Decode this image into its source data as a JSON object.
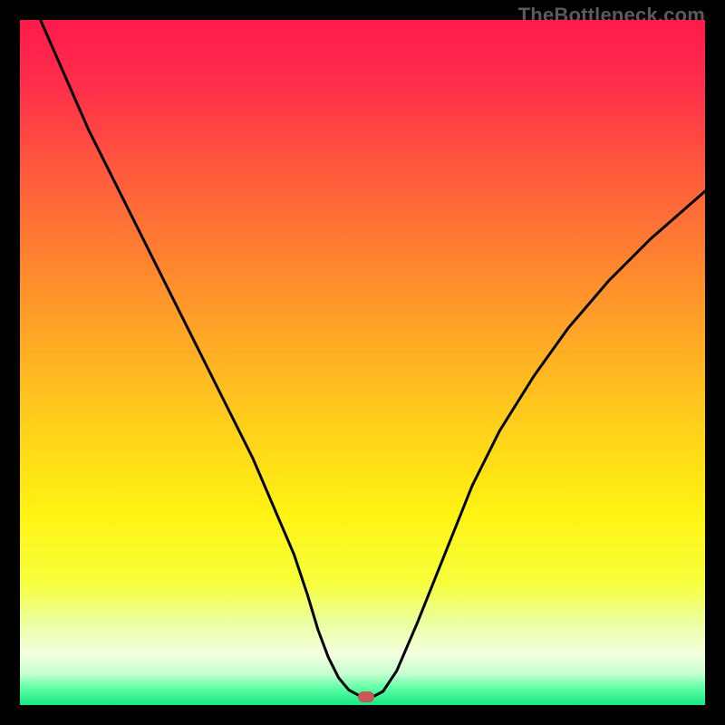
{
  "watermark": "TheBottleneck.com",
  "chart_data": {
    "type": "line",
    "title": "",
    "xlabel": "",
    "ylabel": "",
    "xlim": [
      0,
      100
    ],
    "ylim": [
      0,
      100
    ],
    "grid": false,
    "legend": false,
    "series": [
      {
        "name": "curve",
        "x": [
          3,
          6.5,
          10,
          14,
          18,
          22,
          26,
          30,
          34,
          37,
          40,
          42,
          43.5,
          45,
          46.5,
          48,
          49.5,
          51.5,
          53,
          55,
          58,
          62,
          66,
          70,
          75,
          80,
          86,
          92,
          100
        ],
        "y": [
          100,
          92,
          84,
          76,
          68,
          60,
          52,
          44,
          36,
          29,
          22,
          16,
          11,
          7,
          4,
          2.2,
          1.4,
          1.2,
          2,
          5,
          12,
          22,
          32,
          40,
          48,
          55,
          62,
          68,
          75
        ]
      }
    ],
    "marker": {
      "x": 50.5,
      "y": 1.2,
      "color": "#c85a56"
    },
    "curve_color": "#000000",
    "background_gradient": [
      {
        "offset": 0.0,
        "color": "#ff1a4d"
      },
      {
        "offset": 0.1,
        "color": "#ff2f4a"
      },
      {
        "offset": 0.22,
        "color": "#ff5a3d"
      },
      {
        "offset": 0.35,
        "color": "#ff8330"
      },
      {
        "offset": 0.48,
        "color": "#ffad24"
      },
      {
        "offset": 0.6,
        "color": "#ffd21a"
      },
      {
        "offset": 0.72,
        "color": "#fff312"
      },
      {
        "offset": 0.82,
        "color": "#f7ff3a"
      },
      {
        "offset": 0.88,
        "color": "#ecffa0"
      },
      {
        "offset": 0.925,
        "color": "#f4ffe0"
      },
      {
        "offset": 0.955,
        "color": "#c4ffd0"
      },
      {
        "offset": 0.975,
        "color": "#5effa6"
      },
      {
        "offset": 1.0,
        "color": "#17e885"
      }
    ]
  }
}
